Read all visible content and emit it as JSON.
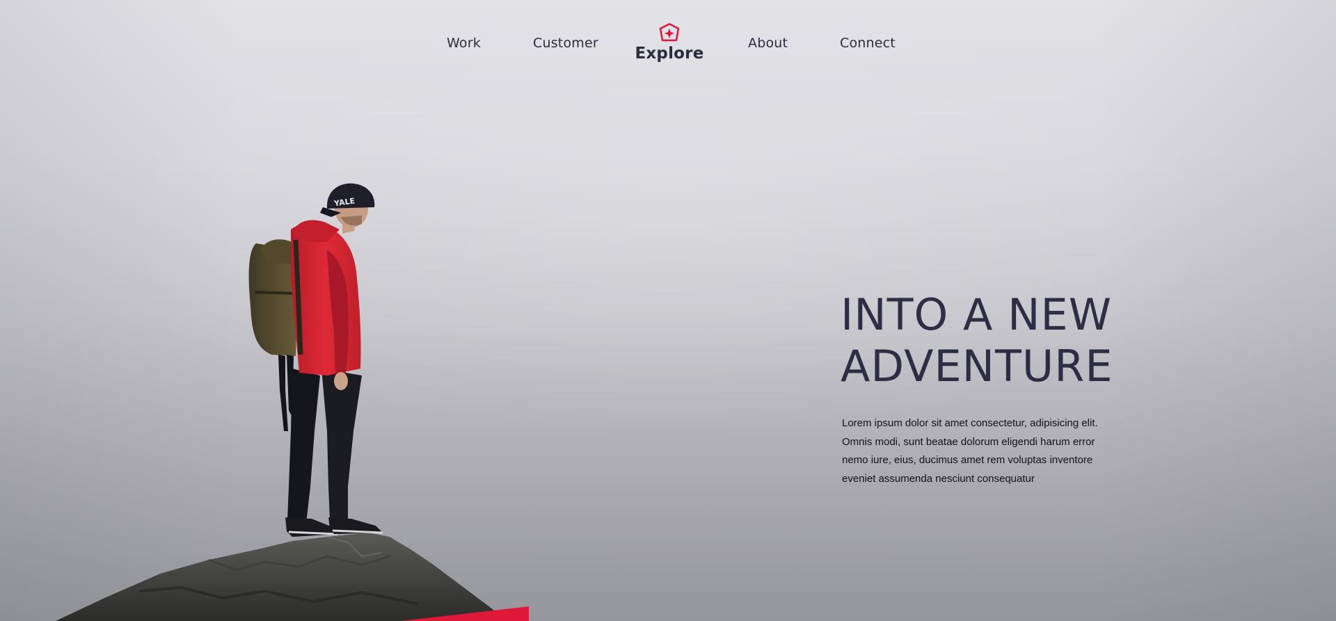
{
  "nav": {
    "items_left": [
      "Work",
      "Customer"
    ],
    "brand": {
      "label": "Explore",
      "icon": "explore-logo-icon"
    },
    "items_right": [
      "About",
      "Connect"
    ]
  },
  "hero": {
    "title_line1": "INTO A NEW",
    "title_line2": "ADVENTURE",
    "description": "Lorem ipsum dolor sit amet consectetur, adipisicing elit. Omnis modi, sunt beatae dolorum eligendi harum error nemo iure, eius, ducimus amet rem voluptas inventore eveniet assumenda nesciunt consequatur"
  },
  "image": {
    "subject": "hiker-on-rock-image",
    "cap_text": "YALE"
  },
  "colors": {
    "accent": "#e0193a",
    "text_dark": "#2a2b3f",
    "background_top": "#e2e2e7",
    "background_bottom": "#95959c"
  }
}
